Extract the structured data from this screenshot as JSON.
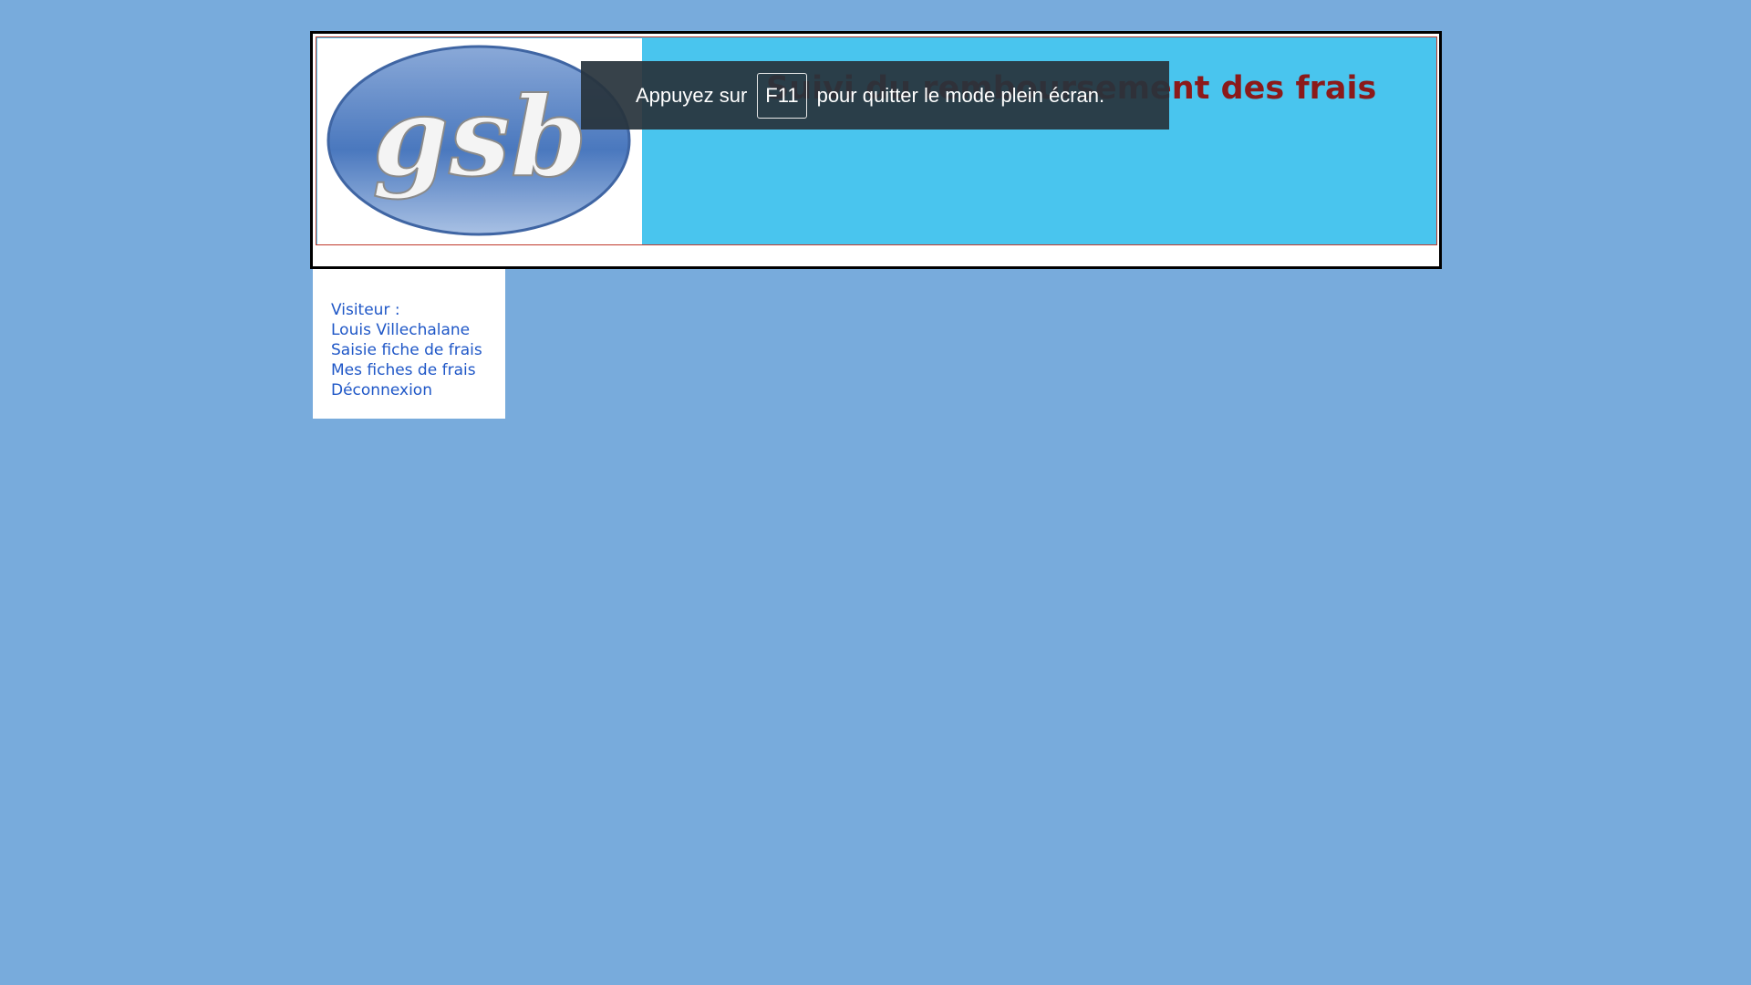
{
  "header": {
    "logo_text": "gsb",
    "title": "Suivi du remboursement des frais"
  },
  "menu": {
    "visitor_label": "Visiteur :",
    "visitor_name": "Louis Villechalane",
    "items": [
      {
        "label": "Saisie fiche de frais"
      },
      {
        "label": "Mes fiches de frais"
      },
      {
        "label": "Déconnexion"
      }
    ]
  },
  "fullscreen_notice": {
    "prefix": "Appuyez sur",
    "key": "F11",
    "suffix": "pour quitter le mode plein écran."
  },
  "colors": {
    "page_background": "#78abdc",
    "header_background": "#49c5ee",
    "title_color": "#8b1a1a",
    "menu_link_color": "#1f57c7"
  }
}
